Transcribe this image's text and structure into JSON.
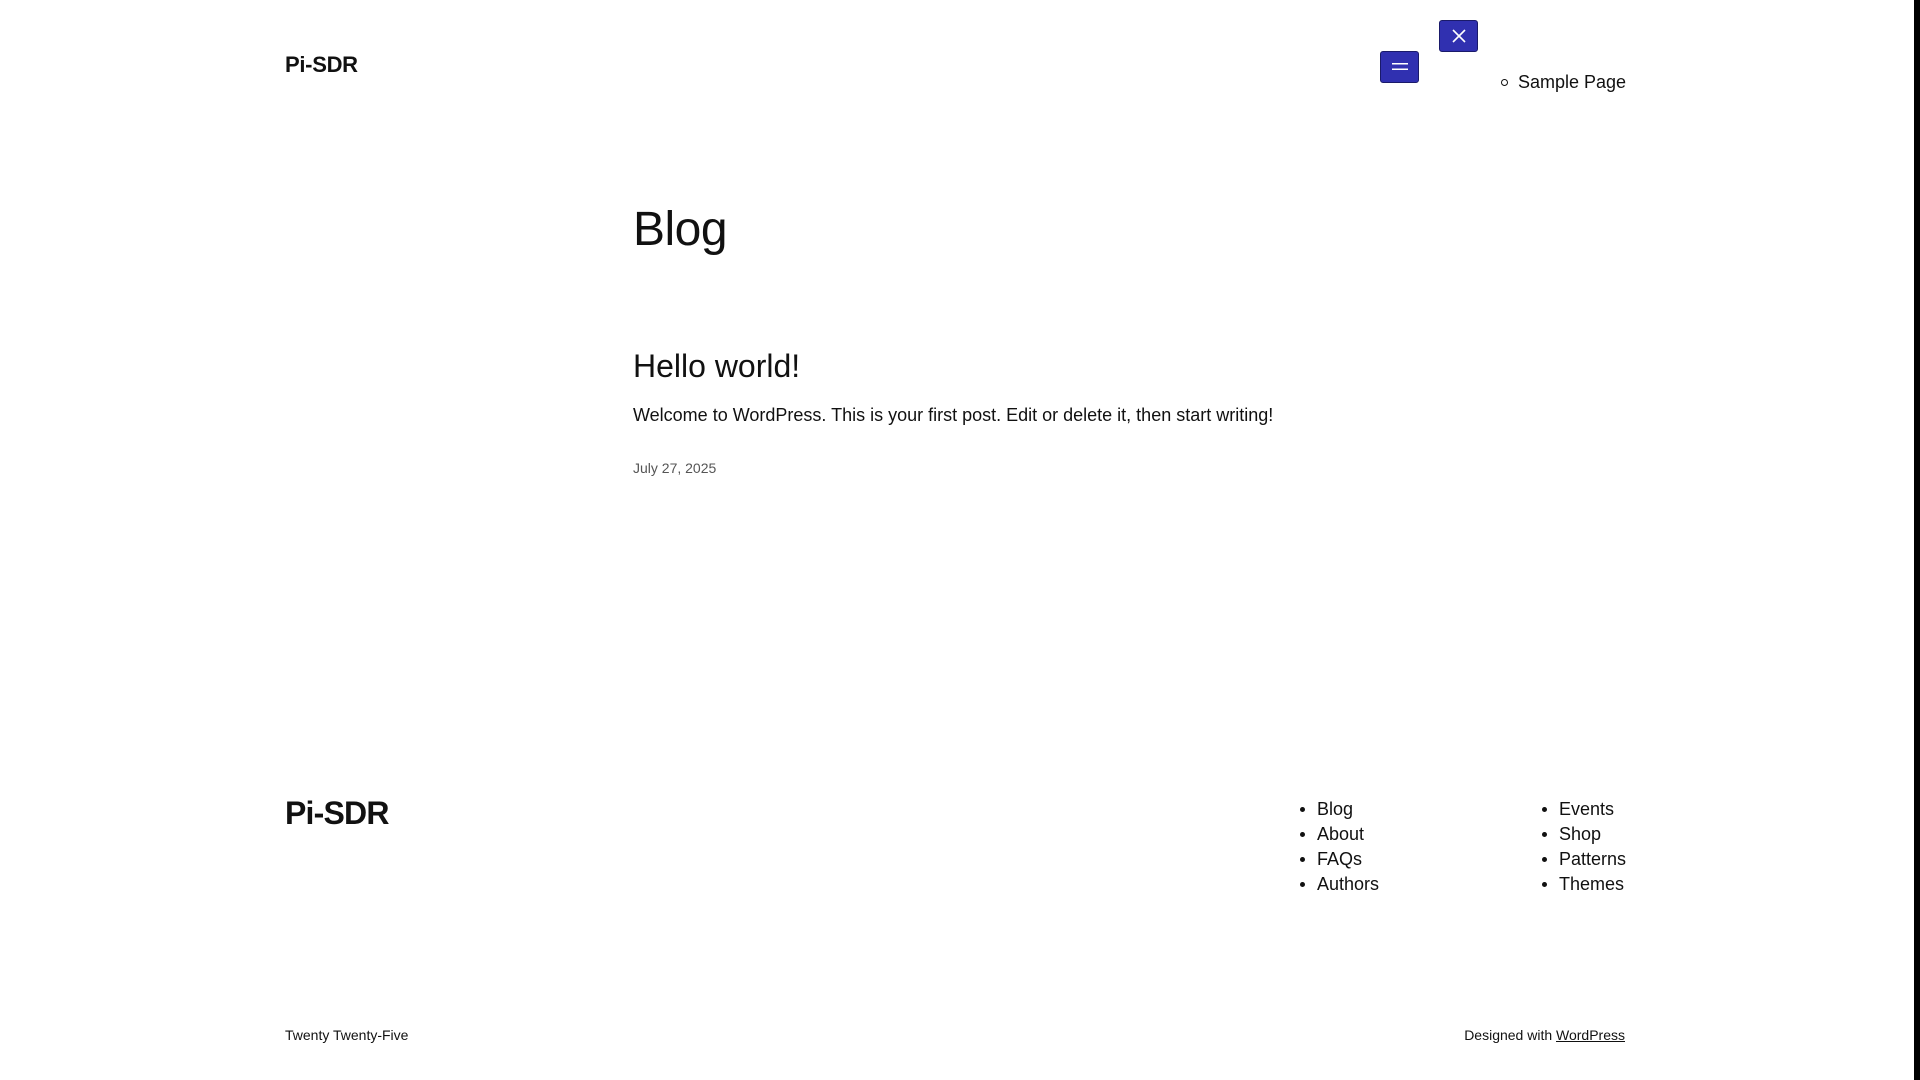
{
  "header": {
    "site_title": "Pi-SDR",
    "nav_items": [
      "Sample Page"
    ]
  },
  "main": {
    "page_heading": "Blog",
    "posts": [
      {
        "title": "Hello world!",
        "excerpt": "Welcome to WordPress. This is your first post. Edit or delete it, then start writing!",
        "date": "July 27, 2025"
      }
    ]
  },
  "footer": {
    "site_title": "Pi-SDR",
    "nav_col_1": [
      "Blog",
      "About",
      "FAQs",
      "Authors"
    ],
    "nav_col_2": [
      "Events",
      "Shop",
      "Patterns",
      "Themes"
    ],
    "theme_credit": "Twenty Twenty-Five",
    "designed_with_prefix": "Designed with",
    "designed_with_link": "WordPress"
  },
  "colors": {
    "button_bg": "#3030b0",
    "text": "#111111",
    "meta_text": "#555555"
  },
  "icons": {
    "open_menu": "hamburger-icon",
    "close_menu": "close-icon"
  }
}
